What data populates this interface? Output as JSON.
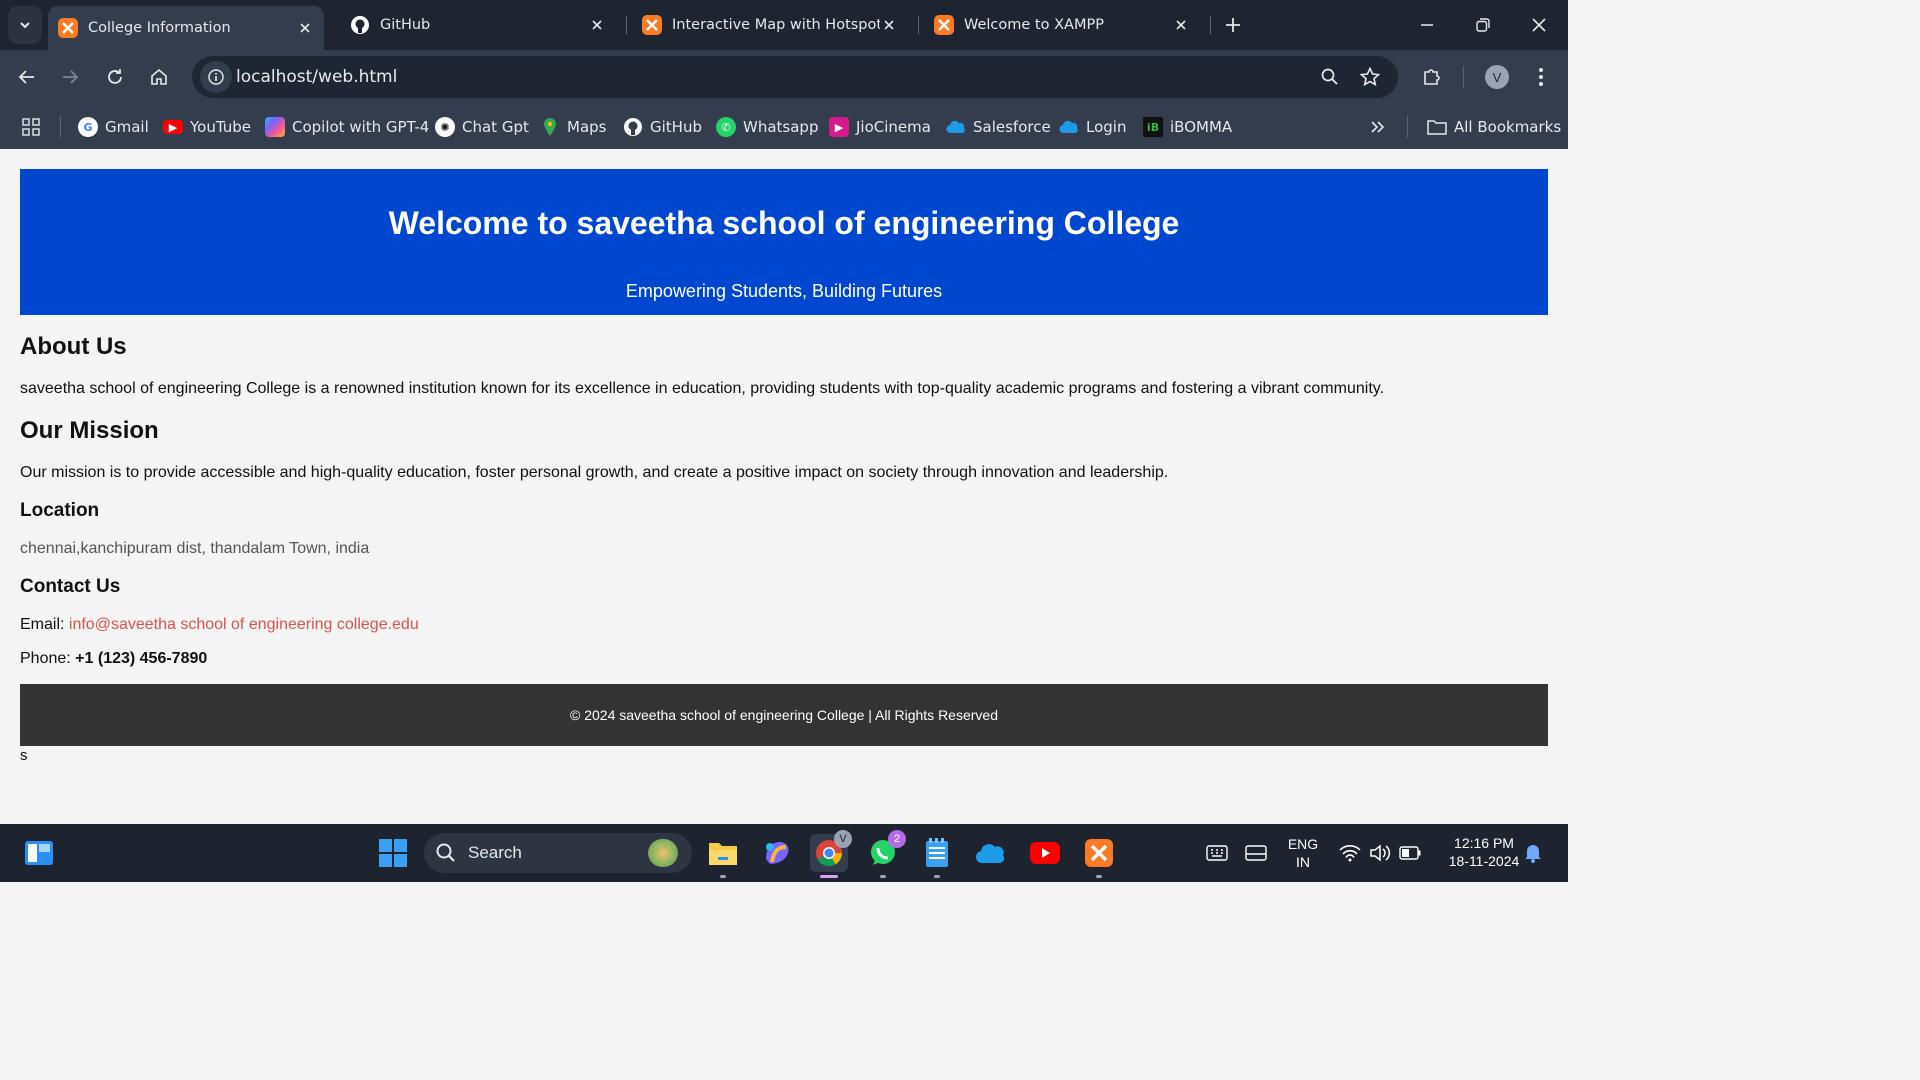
{
  "browser": {
    "tabs": [
      {
        "title": "College Information",
        "active": true,
        "icon": "xampp-icon"
      },
      {
        "title": "GitHub",
        "active": false,
        "icon": "github-icon"
      },
      {
        "title": "Interactive Map with Hotspots",
        "active": false,
        "icon": "xampp-icon"
      },
      {
        "title": "Welcome to XAMPP",
        "active": false,
        "icon": "xampp-icon"
      }
    ],
    "url": "localhost/web.html",
    "profile_initial": "V",
    "bookmarks": [
      {
        "label": "Gmail",
        "icon": "google-icon",
        "color": "#4285f4"
      },
      {
        "label": "YouTube",
        "icon": "youtube-icon",
        "color": "#ff0000"
      },
      {
        "label": "Copilot with GPT-4",
        "icon": "copilot-icon",
        "color": "#7b61ff"
      },
      {
        "label": "Chat Gpt",
        "icon": "chatgpt-icon",
        "color": "#ffffff"
      },
      {
        "label": "Maps",
        "icon": "maps-icon",
        "color": "#34a853"
      },
      {
        "label": "GitHub",
        "icon": "github-icon",
        "color": "#ffffff"
      },
      {
        "label": "Whatsapp",
        "icon": "whatsapp-icon",
        "color": "#25d366"
      },
      {
        "label": "JioCinema",
        "icon": "jiocinema-icon",
        "color": "#d6198b"
      },
      {
        "label": "Salesforce",
        "icon": "salesforce-icon",
        "color": "#1e9be8"
      },
      {
        "label": "Login",
        "icon": "salesforce-icon",
        "color": "#1e9be8"
      },
      {
        "label": "iBOMMA",
        "icon": "ibomma-icon",
        "color": "#3cb64a"
      }
    ],
    "all_bookmarks": "All Bookmarks"
  },
  "page": {
    "header_title": "Welcome to saveetha school of engineering College",
    "header_subtitle": "Empowering Students, Building Futures",
    "about_heading": "About Us",
    "about_text": "saveetha school of engineering College is a renowned institution known for its excellence in education, providing students with top-quality academic programs and fostering a vibrant community.",
    "mission_heading": "Our Mission",
    "mission_text": "Our mission is to provide accessible and high-quality education, foster personal growth, and create a positive impact on society through innovation and leadership.",
    "location_heading": "Location",
    "location_text": "chennai,kanchipuram dist, thandalam Town, india",
    "contact_heading": "Contact Us",
    "email_label": "Email:",
    "email_value": "info@saveetha school of engineering college.edu",
    "phone_label": "Phone:",
    "phone_value": "+1 (123) 456-7890",
    "footer_text": "© 2024 saveetha school of engineering College | All Rights Reserved",
    "stray_text": "s",
    "colors": {
      "header_bg": "#0047cf",
      "footer_bg": "#333333",
      "link": "#d9534f"
    }
  },
  "taskbar": {
    "search_placeholder": "Search",
    "whatsapp_badge": "2",
    "language": "ENG",
    "region": "IN",
    "time": "12:16 PM",
    "date": "18-11-2024"
  }
}
